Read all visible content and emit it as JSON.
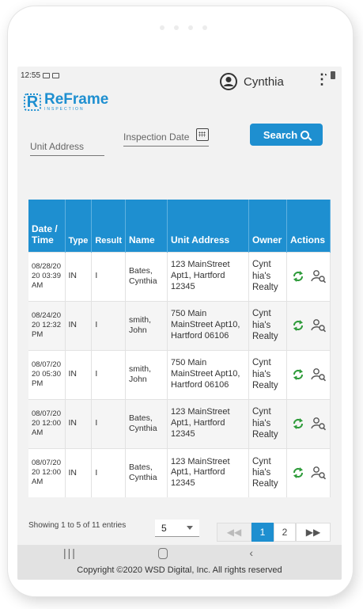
{
  "status_bar": {
    "time": "12:55"
  },
  "app": {
    "logo_mark": "R",
    "logo_name": "ReFrame",
    "logo_sub": "INSPECTION",
    "user_name": "Cynthia",
    "menu_icon": "kebab-icon"
  },
  "search": {
    "unit_address_placeholder": "Unit Address",
    "inspection_date_placeholder": "Inspection Date",
    "button_label": "Search"
  },
  "table": {
    "headers": [
      "Date / Time",
      "Type",
      "Result",
      "Name",
      "Unit Address",
      "Owner",
      "Actions"
    ],
    "rows": [
      {
        "date": "08/28/20 20 03:39 AM",
        "type": "IN",
        "result": "I",
        "name": "Bates, Cynthia",
        "address": "123 MainStreet Apt1, Hartford 12345",
        "owner": "Cynt hia's Realty"
      },
      {
        "date": "08/24/20 20 12:32 PM",
        "type": "IN",
        "result": "I",
        "name": "smith, John",
        "address": "750 Main MainStreet Apt10, Hartford 06106",
        "owner": "Cynt hia's Realty"
      },
      {
        "date": "08/07/20 20 05:30 PM",
        "type": "IN",
        "result": "I",
        "name": "smith, John",
        "address": "750 Main MainStreet Apt10, Hartford 06106",
        "owner": "Cynt hia's Realty"
      },
      {
        "date": "08/07/20 20 12:00 AM",
        "type": "IN",
        "result": "I",
        "name": "Bates, Cynthia",
        "address": "123 MainStreet Apt1, Hartford 12345",
        "owner": "Cynt hia's Realty"
      },
      {
        "date": "08/07/20 20 12:00 AM",
        "type": "IN",
        "result": "I",
        "name": "Bates, Cynthia",
        "address": "123 MainStreet Apt1, Hartford 12345",
        "owner": "Cynt hia's Realty"
      }
    ]
  },
  "pagination": {
    "showing": "Showing 1 to 5 of 11 entries",
    "page_size": "5",
    "pages": [
      "1",
      "2"
    ],
    "current_page": "1"
  },
  "footer": {
    "copyright": "Copyright ©2020 WSD Digital, Inc. All rights reserved"
  },
  "colors": {
    "accent": "#1e8fd0",
    "action_green": "#2e9b3a"
  }
}
